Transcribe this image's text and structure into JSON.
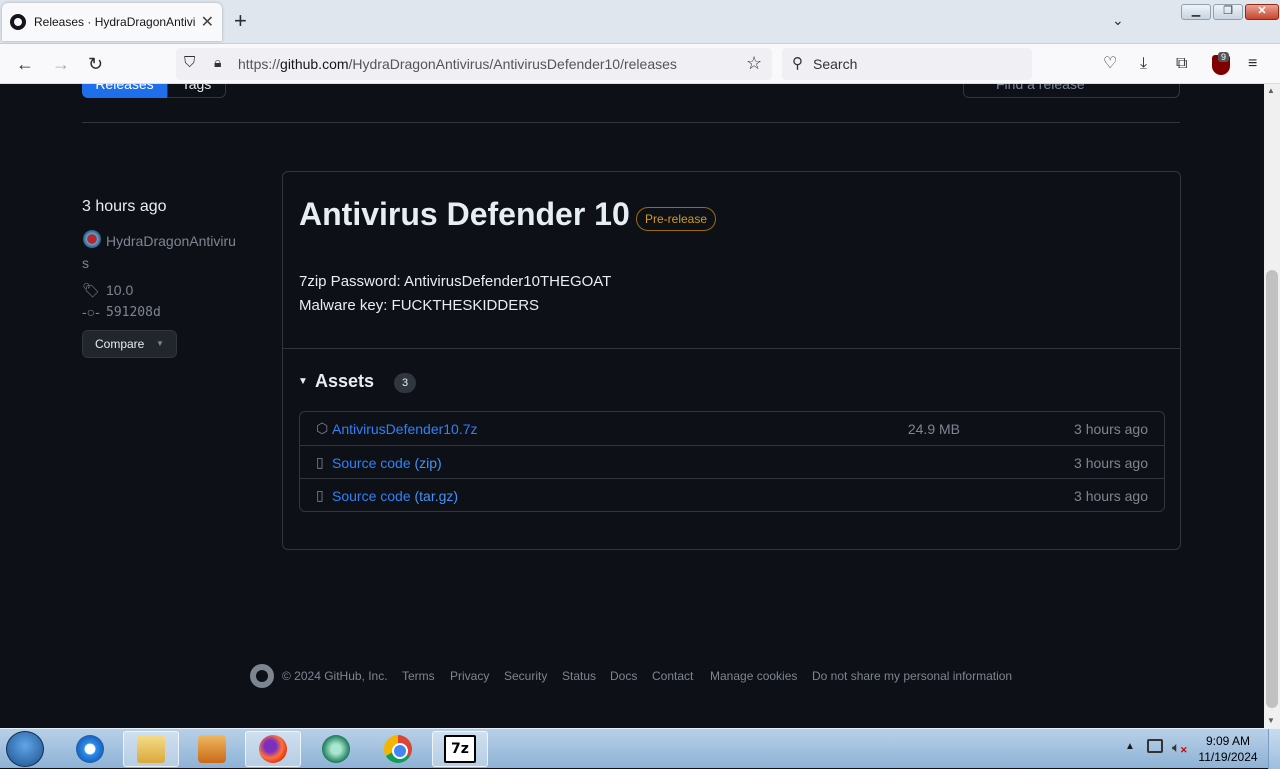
{
  "browser": {
    "tab_title": "Releases · HydraDragonAntiviru",
    "tab_close": "✕",
    "new_tab": "+",
    "url_prefix": "https://",
    "url_host": "github.com",
    "url_path": "/HydraDragonAntivirus/AntivirusDefender10/releases",
    "search_placeholder": "Search",
    "ublock_badge": "9"
  },
  "page": {
    "tabs": {
      "releases": "Releases",
      "tags": "Tags"
    },
    "find_placeholder": "Find a release"
  },
  "release": {
    "time": "3 hours ago",
    "author": "HydraDragonAntivirus",
    "tag": "10.0",
    "commit": "591208d",
    "compare_label": "Compare",
    "title": "Antivirus Defender 10",
    "badge": "Pre-release",
    "body_line1": "7zip Password: AntivirusDefender10THEGOAT",
    "body_line2": "Malware key: FUCKTHESKIDDERS",
    "assets_title": "Assets",
    "assets_count": "3",
    "assets": [
      {
        "name": "AntivirusDefender10.7z",
        "ext": "",
        "size": "24.9 MB",
        "time": "3 hours ago",
        "icon": "package-icon"
      },
      {
        "name": "Source code ",
        "ext": "(zip)",
        "size": "",
        "time": "3 hours ago",
        "icon": "file-zip-icon"
      },
      {
        "name": "Source code ",
        "ext": "(tar.gz)",
        "size": "",
        "time": "3 hours ago",
        "icon": "file-zip-icon"
      }
    ]
  },
  "footer": {
    "copyright": "© 2024 GitHub, Inc.",
    "links": [
      "Terms",
      "Privacy",
      "Security",
      "Status",
      "Docs",
      "Contact",
      "Manage cookies",
      "Do not share my personal information"
    ]
  },
  "taskbar": {
    "apps": [
      "start",
      "internet-explorer",
      "file-explorer",
      "media-center",
      "firefox",
      "bitdefender",
      "chrome",
      "7zip"
    ],
    "zip_label": "7z",
    "clock_time": "9:09 AM",
    "clock_date": "11/19/2024"
  },
  "colors": {
    "page_bg": "#0d1117",
    "accent": "#1f6feb",
    "link": "#2f81f7",
    "prerelease": "#d29922"
  }
}
